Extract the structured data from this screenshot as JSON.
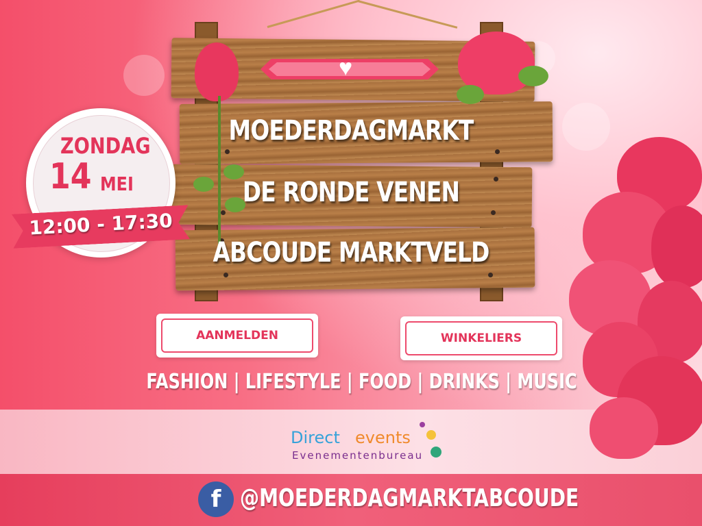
{
  "sign": {
    "line1": "MOEDERDAGMARKT",
    "line2": "DE RONDE VENEN",
    "line3": "ABCOUDE MARKTVELD"
  },
  "date": {
    "weekday": "ZONDAG",
    "day": "14",
    "month": "MEI",
    "time": "12:00 - 17:30"
  },
  "buttons": {
    "register": "AANMELDEN",
    "shops": "WINKELIERS"
  },
  "categories": "FASHION | LIFESTYLE | FOOD | DRINKS | MUSIC",
  "logo": {
    "word1": "Direct",
    "word2": "events",
    "subtitle": "Evenementenbureau"
  },
  "social": {
    "icon": "facebook-icon",
    "handle": "@MOEDERDAGMARKTABCOUDE"
  },
  "colors": {
    "primary_pink": "#e3345a",
    "background_pink": "#f0607a",
    "wood": "#b97f48",
    "facebook_blue": "#3a5da4"
  }
}
